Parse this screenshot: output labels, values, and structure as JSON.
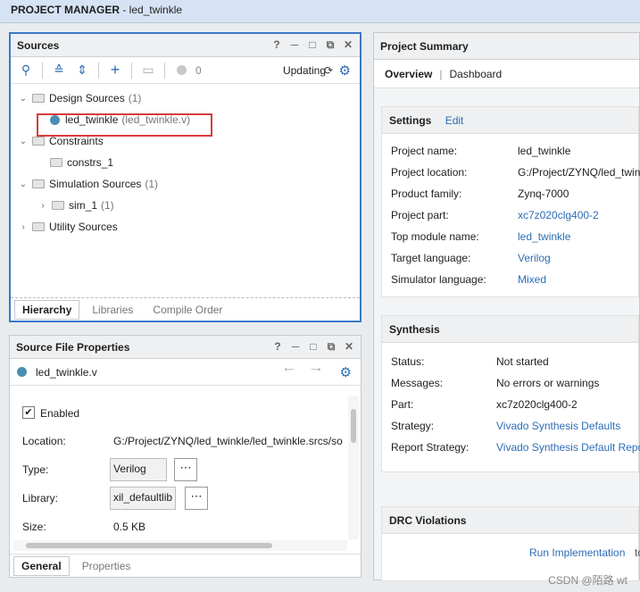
{
  "window": {
    "title_bold": "PROJECT MANAGER",
    "title_rest": " - led_twinkle"
  },
  "sources": {
    "title": "Sources",
    "header_icons": [
      "help-icon",
      "minimize-icon",
      "maximize-icon",
      "restore-icon",
      "close-icon"
    ],
    "toolbar": {
      "count": "0",
      "status": "Updating"
    },
    "tree": [
      {
        "label": "Design Sources",
        "count": "(1)",
        "expanded": true,
        "level": 0
      },
      {
        "label": "led_twinkle",
        "sub": "(led_twinkle.v)",
        "level": 1,
        "selected": true
      },
      {
        "label": "Constraints",
        "count": "",
        "expanded": true,
        "level": 0
      },
      {
        "label": "constrs_1",
        "count": "",
        "level": 1
      },
      {
        "label": "Simulation Sources",
        "count": "(1)",
        "expanded": true,
        "level": 0
      },
      {
        "label": "sim_1",
        "count": "(1)",
        "expanded": false,
        "level": 1
      },
      {
        "label": "Utility Sources",
        "count": "",
        "expanded": false,
        "level": 0
      }
    ],
    "tabs": [
      "Hierarchy",
      "Libraries",
      "Compile Order"
    ]
  },
  "sfp": {
    "title": "Source File Properties",
    "file": "led_twinkle.v",
    "enabled_label": "Enabled",
    "location_label": "Location:",
    "location_value": "G:/Project/ZYNQ/led_twinkle/led_twinkle.srcs/so",
    "type_label": "Type:",
    "type_value": "Verilog",
    "library_label": "Library:",
    "library_value": "xil_defaultlib",
    "size_label": "Size:",
    "size_value": "0.5 KB",
    "dots": "⋯",
    "tabs": [
      "General",
      "Properties"
    ]
  },
  "summary": {
    "title": "Project Summary",
    "tabs": [
      "Overview",
      "Dashboard"
    ],
    "tab_sep": "|",
    "settings": {
      "title": "Settings",
      "edit": "Edit",
      "rows": [
        {
          "k": "Project name:",
          "v": "led_twinkle",
          "link": false
        },
        {
          "k": "Project location:",
          "v": "G:/Project/ZYNQ/led_twinkle",
          "link": false
        },
        {
          "k": "Product family:",
          "v": "Zynq-7000",
          "link": false
        },
        {
          "k": "Project part:",
          "v": "xc7z020clg400-2",
          "link": true
        },
        {
          "k": "Top module name:",
          "v": "led_twinkle",
          "link": true
        },
        {
          "k": "Target language:",
          "v": "Verilog",
          "link": true
        },
        {
          "k": "Simulator language:",
          "v": "Mixed",
          "link": true
        }
      ]
    },
    "synthesis": {
      "title": "Synthesis",
      "rows": [
        {
          "k": "Status:",
          "v": "Not started",
          "link": false
        },
        {
          "k": "Messages:",
          "v": "No errors or warnings",
          "link": false
        },
        {
          "k": "Part:",
          "v": "xc7z020clg400-2",
          "link": false
        },
        {
          "k": "Strategy:",
          "v": "Vivado Synthesis Defaults",
          "link": true
        },
        {
          "k": "Report Strategy:",
          "v": "Vivado Synthesis Default Reports",
          "link": true
        }
      ]
    },
    "drc": {
      "title": "DRC Violations",
      "run_impl": "Run Implementation",
      "run_impl_tail": "to"
    }
  },
  "watermark": "CSDN @陌路 wt"
}
